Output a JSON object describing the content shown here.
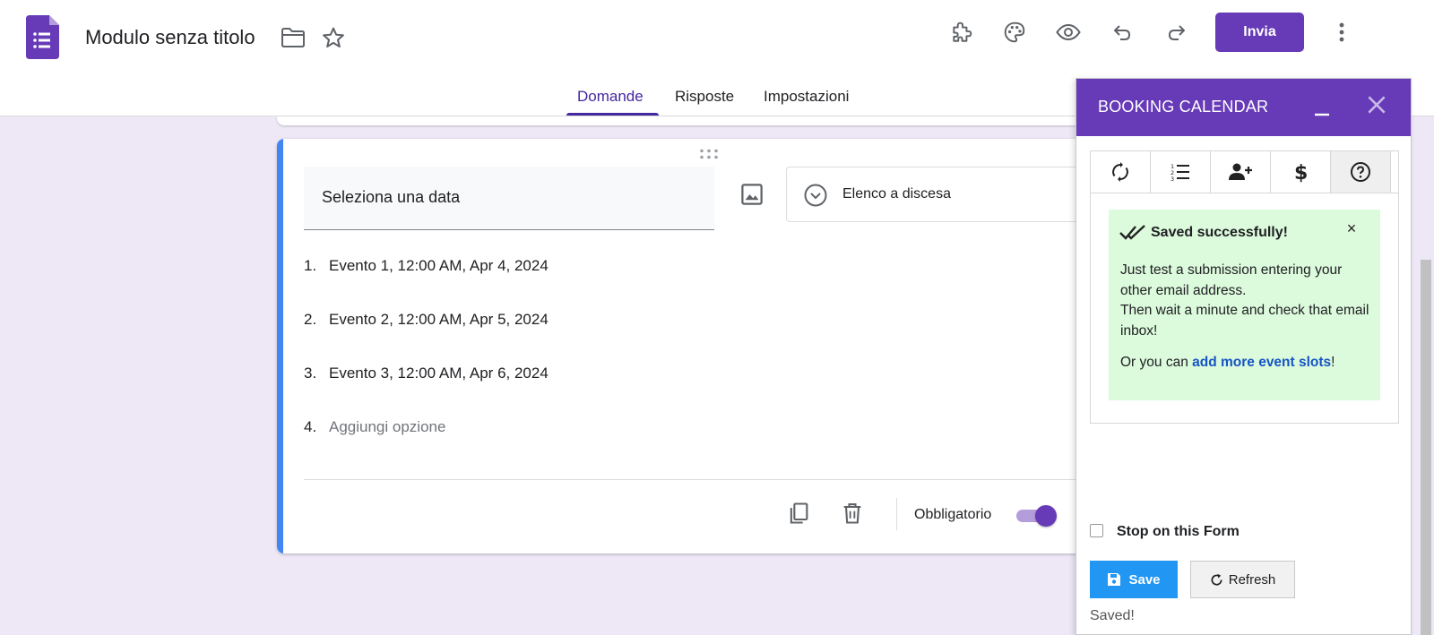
{
  "header": {
    "title": "Modulo senza titolo",
    "send_label": "Invia",
    "tabs": [
      {
        "label": "Domande",
        "active": true
      },
      {
        "label": "Risposte",
        "active": false
      },
      {
        "label": "Impostazioni",
        "active": false
      }
    ],
    "icons": [
      "forms-logo-icon",
      "folder-icon",
      "star-icon",
      "puzzle-addon-icon",
      "palette-icon",
      "eye-preview-icon",
      "undo-icon",
      "redo-icon",
      "more-vert-icon"
    ]
  },
  "question": {
    "title": "Seleziona una data",
    "type_label": "Elenco a discesa",
    "options": [
      {
        "num": "1.",
        "text": "Evento 1, 12:00 AM, Apr 4, 2024"
      },
      {
        "num": "2.",
        "text": "Evento 2, 12:00 AM, Apr 5, 2024"
      },
      {
        "num": "3.",
        "text": "Evento 3, 12:00 AM, Apr 6, 2024"
      }
    ],
    "add_option": {
      "num": "4.",
      "text": "Aggiungi opzione"
    },
    "required_label": "Obbligatorio",
    "required": true
  },
  "panel": {
    "title": "BOOKING CALENDAR",
    "tabs": [
      "sync-icon",
      "list-numbered-icon",
      "person-add-icon",
      "dollar-icon",
      "help-icon"
    ],
    "alert": {
      "title": "Saved successfully!",
      "close": "×",
      "message_line1": "Just test a submission entering your other email address.",
      "message_line2": "Then wait a minute and check that email inbox!",
      "more_prefix": "Or you can ",
      "more_link": "add more event slots",
      "more_suffix": "!"
    },
    "stop_label": "Stop on this Form",
    "stop_checked": false,
    "save_label": "Save",
    "refresh_label": "Refresh",
    "status": "Saved!"
  },
  "colors": {
    "brand_purple": "#673ab7",
    "accent_blue": "#4285f4",
    "page_bg": "#ede7f6",
    "alert_bg": "#dcfadc",
    "save_blue": "#2196f3"
  }
}
